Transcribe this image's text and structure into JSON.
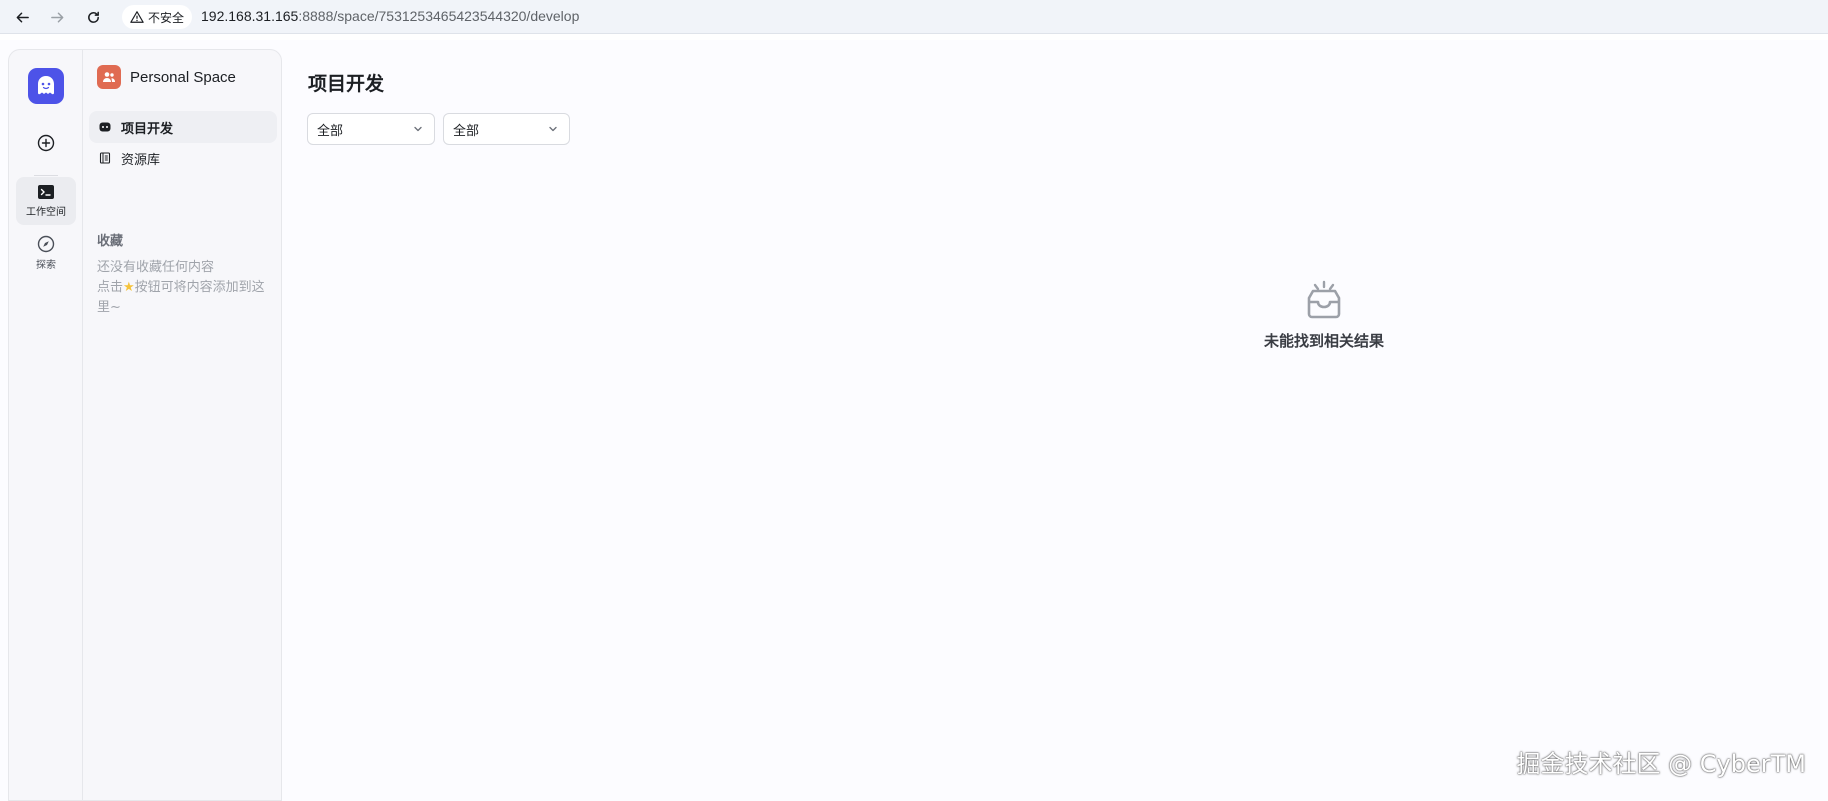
{
  "browser": {
    "back_icon": "arrow-left-icon",
    "forward_icon": "arrow-right-icon",
    "reload_icon": "reload-icon",
    "security_icon": "warning-triangle-icon",
    "security_label": "不安全",
    "url_host": "192.168.31.165",
    "url_path": ":8888/space/7531253465423544320/develop"
  },
  "rail": {
    "logo_icon": "bot-logo-icon",
    "add_icon": "plus-circle-icon",
    "items": [
      {
        "label": "工作空间",
        "icon": "terminal-folder-icon",
        "active": true
      },
      {
        "label": "探索",
        "icon": "compass-icon",
        "active": false
      }
    ]
  },
  "sidebar": {
    "space_icon": "users-icon",
    "space_name": "Personal Space",
    "items": [
      {
        "label": "项目开发",
        "icon": "bot-face-icon",
        "active": true
      },
      {
        "label": "资源库",
        "icon": "library-icon",
        "active": false
      }
    ],
    "favorites_title": "收藏",
    "favorites_empty_line1": "还没有收藏任何内容",
    "favorites_empty_line2_a": "点击",
    "favorites_empty_line2_b": "按钮可将内容添加到这里~"
  },
  "main": {
    "title": "项目开发",
    "filters": [
      {
        "value": "全部"
      },
      {
        "value": "全部"
      }
    ],
    "empty_icon": "empty-inbox-icon",
    "empty_text": "未能找到相关结果"
  },
  "watermark": "掘金技术社区 @ CyberTM",
  "colors": {
    "brand": "#4d53e8",
    "space_icon_bg": "#e06b52",
    "star": "#f5c33b"
  }
}
